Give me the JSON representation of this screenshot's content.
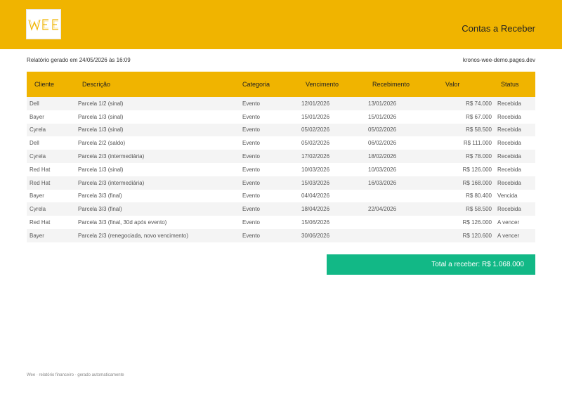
{
  "header": {
    "logo_text": "WEE",
    "title": "Contas a Receber"
  },
  "meta": {
    "generated": "Relatório gerado em 24/05/2026 às 16:09",
    "site": "kronos-wee-demo.pages.dev"
  },
  "table": {
    "columns": [
      "Cliente",
      "Descrição",
      "Categoria",
      "Vencimento",
      "Recebimento",
      "Valor",
      "Status"
    ],
    "rows": [
      [
        "Dell",
        "Parcela 1/2 (sinal)",
        "Evento",
        "12/01/2026",
        "13/01/2026",
        "R$ 74.000",
        "Recebida"
      ],
      [
        "Bayer",
        "Parcela 1/3 (sinal)",
        "Evento",
        "15/01/2026",
        "15/01/2026",
        "R$ 67.000",
        "Recebida"
      ],
      [
        "Cyrela",
        "Parcela 1/3 (sinal)",
        "Evento",
        "05/02/2026",
        "05/02/2026",
        "R$ 58.500",
        "Recebida"
      ],
      [
        "Dell",
        "Parcela 2/2 (saldo)",
        "Evento",
        "05/02/2026",
        "06/02/2026",
        "R$ 111.000",
        "Recebida"
      ],
      [
        "Cyrela",
        "Parcela 2/3 (intermediária)",
        "Evento",
        "17/02/2026",
        "18/02/2026",
        "R$ 78.000",
        "Recebida"
      ],
      [
        "Red Hat",
        "Parcela 1/3 (sinal)",
        "Evento",
        "10/03/2026",
        "10/03/2026",
        "R$ 126.000",
        "Recebida"
      ],
      [
        "Red Hat",
        "Parcela 2/3 (intermediária)",
        "Evento",
        "15/03/2026",
        "16/03/2026",
        "R$ 168.000",
        "Recebida"
      ],
      [
        "Bayer",
        "Parcela 3/3 (final)",
        "Evento",
        "04/04/2026",
        "",
        "R$ 80.400",
        "Vencida"
      ],
      [
        "Cyrela",
        "Parcela 3/3 (final)",
        "Evento",
        "18/04/2026",
        "22/04/2026",
        "R$ 58.500",
        "Recebida"
      ],
      [
        "Red Hat",
        "Parcela 3/3 (final, 30d após evento)",
        "Evento",
        "15/06/2026",
        "",
        "R$ 126.000",
        "A vencer"
      ],
      [
        "Bayer",
        "Parcela 2/3 (renegociada, novo vencimento)",
        "Evento",
        "30/06/2026",
        "",
        "R$ 120.600",
        "A vencer"
      ]
    ]
  },
  "total": {
    "label": "Total a receber: R$ 1.068.000"
  },
  "footer": {
    "text": "Wee · relatório financeiro · gerado automaticamente"
  },
  "colors": {
    "brand": "#f0b400",
    "total": "#12b886"
  }
}
